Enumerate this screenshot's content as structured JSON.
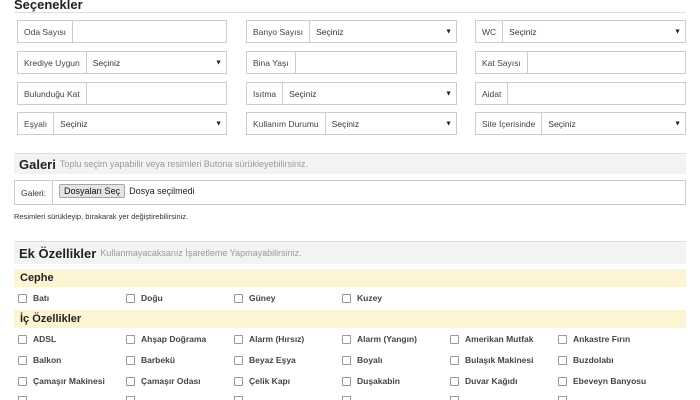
{
  "options": {
    "title": "Seçenekler",
    "fields": [
      {
        "label": "Oda Sayısı",
        "value": "",
        "type": "text"
      },
      {
        "label": "Banyo Sayısı",
        "value": "Seçiniz",
        "type": "select"
      },
      {
        "label": "WC",
        "value": "Seçiniz",
        "type": "select"
      },
      {
        "label": "Krediye Uygun",
        "value": "Seçiniz",
        "type": "select"
      },
      {
        "label": "Bina Yaşı",
        "value": "",
        "type": "text"
      },
      {
        "label": "Kat Sayısı",
        "value": "",
        "type": "text"
      },
      {
        "label": "Bulunduğu Kat",
        "value": "",
        "type": "text"
      },
      {
        "label": "Isıtma",
        "value": "Seçiniz",
        "type": "select"
      },
      {
        "label": "Aidat",
        "value": "",
        "type": "text"
      },
      {
        "label": "Eşyalı",
        "value": "Seçiniz",
        "type": "select"
      },
      {
        "label": "Kullanım Durumu",
        "value": "Seçiniz",
        "type": "select"
      },
      {
        "label": "Site İçerisinde",
        "value": "Seçiniz",
        "type": "select"
      }
    ]
  },
  "gallery": {
    "title": "Galeri",
    "subtitle": "Toplu seçim yapabilir veya resimleri Butona sürükleyebilirsiniz.",
    "label": "Galeri:",
    "button": "Dosyaları Seç",
    "status": "Dosya seçilmedi",
    "note": "Resimleri sürükleyip, bırakarak yer değiştirebilirsiniz."
  },
  "extras": {
    "title": "Ek Özellikler",
    "subtitle": "Kullanmayacaksanız İşaretleme Yapmayabilirsiniz.",
    "groups": [
      {
        "title": "Cephe",
        "items": [
          "Batı",
          "Doğu",
          "Güney",
          "Kuzey"
        ]
      },
      {
        "title": "İç Özellikler",
        "items": [
          "ADSL",
          "Ahşap Doğrama",
          "Alarm (Hırsız)",
          "Alarm (Yangın)",
          "Amerikan Mutfak",
          "Ankastre Fırın",
          "Balkon",
          "Barbekü",
          "Beyaz Eşya",
          "Boyalı",
          "Bulaşık Makinesi",
          "Buzdolabı",
          "Çamaşır Makinesi",
          "Çamaşır Odası",
          "Çelik Kapı",
          "Duşakabin",
          "Duvar Kağıdı",
          "Ebeveyn Banyosu"
        ]
      }
    ]
  }
}
